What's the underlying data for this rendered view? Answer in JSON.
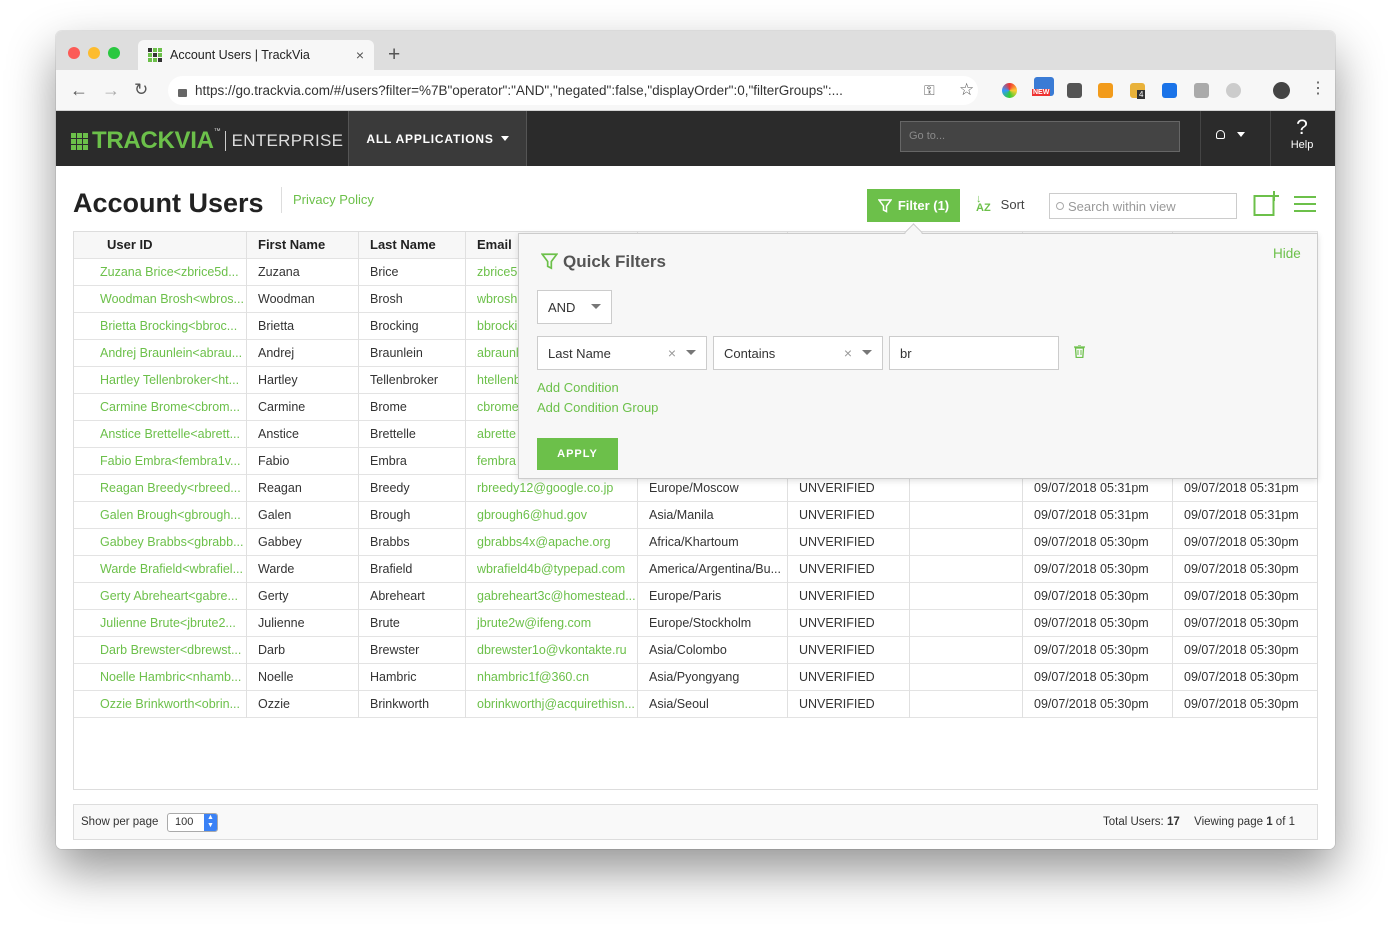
{
  "browser": {
    "tab_title": "Account Users | TrackVia",
    "new_tab": "+",
    "url": "https://go.trackvia.com/#/users?filter=%7B\"operator\":\"AND\",\"negated\":false,\"displayOrder\":0,\"filterGroups\":...",
    "ext_new_badge": "NEW",
    "ext_count_badge": "4"
  },
  "app": {
    "logo_main": "TRACKVIA",
    "logo_tm": "™",
    "logo_sub": "ENTERPRISE",
    "all_apps": "ALL APPLICATIONS",
    "goto_placeholder": "Go to...",
    "help_icon": "?",
    "help": "Help"
  },
  "page": {
    "title": "Account Users",
    "privacy": "Privacy Policy",
    "filter_btn": "Filter (1)",
    "sort": "Sort",
    "search_placeholder": "Search within view"
  },
  "table": {
    "headers": [
      "User ID",
      "First Name",
      "Last Name",
      "Email"
    ],
    "rows": [
      [
        "Zuzana Brice<zbrice5d...",
        "Zuzana",
        "Brice",
        "zbrice5",
        "",
        "",
        "",
        "",
        ""
      ],
      [
        "Woodman Brosh<wbros...",
        "Woodman",
        "Brosh",
        "wbrosh",
        "",
        "",
        "",
        "",
        ""
      ],
      [
        "Brietta Brocking<bbroc...",
        "Brietta",
        "Brocking",
        "bbrocki",
        "",
        "",
        "",
        "",
        ""
      ],
      [
        "Andrej Braunlein<abrau...",
        "Andrej",
        "Braunlein",
        "abraunl",
        "",
        "",
        "",
        "",
        ""
      ],
      [
        "Hartley Tellenbroker<ht...",
        "Hartley",
        "Tellenbroker",
        "htellenb",
        "",
        "",
        "",
        "",
        ""
      ],
      [
        "Carmine Brome<cbrom...",
        "Carmine",
        "Brome",
        "cbrome",
        "",
        "",
        "",
        "",
        ""
      ],
      [
        "Anstice Brettelle<abrett...",
        "Anstice",
        "Brettelle",
        "abrette",
        "",
        "",
        "",
        "",
        ""
      ],
      [
        "Fabio Embra<fembra1v...",
        "Fabio",
        "Embra",
        "fembra",
        "",
        "",
        "",
        "",
        ""
      ],
      [
        "Reagan Breedy<rbreed...",
        "Reagan",
        "Breedy",
        "rbreedy12@google.co.jp",
        "Europe/Moscow",
        "UNVERIFIED",
        "",
        "09/07/2018 05:31pm",
        "09/07/2018 05:31pm"
      ],
      [
        "Galen Brough<gbrough...",
        "Galen",
        "Brough",
        "gbrough6@hud.gov",
        "Asia/Manila",
        "UNVERIFIED",
        "",
        "09/07/2018 05:31pm",
        "09/07/2018 05:31pm"
      ],
      [
        "Gabbey Brabbs<gbrabb...",
        "Gabbey",
        "Brabbs",
        "gbrabbs4x@apache.org",
        "Africa/Khartoum",
        "UNVERIFIED",
        "",
        "09/07/2018 05:30pm",
        "09/07/2018 05:30pm"
      ],
      [
        "Warde Brafield<wbrafiel...",
        "Warde",
        "Brafield",
        "wbrafield4b@typepad.com",
        "America/Argentina/Bu...",
        "UNVERIFIED",
        "",
        "09/07/2018 05:30pm",
        "09/07/2018 05:30pm"
      ],
      [
        "Gerty Abreheart<gabre...",
        "Gerty",
        "Abreheart",
        "gabreheart3c@homestead...",
        "Europe/Paris",
        "UNVERIFIED",
        "",
        "09/07/2018 05:30pm",
        "09/07/2018 05:30pm"
      ],
      [
        "Julienne Brute<jbrute2...",
        "Julienne",
        "Brute",
        "jbrute2w@ifeng.com",
        "Europe/Stockholm",
        "UNVERIFIED",
        "",
        "09/07/2018 05:30pm",
        "09/07/2018 05:30pm"
      ],
      [
        "Darb Brewster<dbrewst...",
        "Darb",
        "Brewster",
        "dbrewster1o@vkontakte.ru",
        "Asia/Colombo",
        "UNVERIFIED",
        "",
        "09/07/2018 05:30pm",
        "09/07/2018 05:30pm"
      ],
      [
        "Noelle Hambric<nhamb...",
        "Noelle",
        "Hambric",
        "nhambric1f@360.cn",
        "Asia/Pyongyang",
        "UNVERIFIED",
        "",
        "09/07/2018 05:30pm",
        "09/07/2018 05:30pm"
      ],
      [
        "Ozzie Brinkworth<obrin...",
        "Ozzie",
        "Brinkworth",
        "obrinkworthj@acquirethisn...",
        "Asia/Seoul",
        "UNVERIFIED",
        "",
        "09/07/2018 05:30pm",
        "09/07/2018 05:30pm"
      ]
    ]
  },
  "footer": {
    "per_page_label": "Show per page",
    "per_page_value": "100",
    "total_label": "Total Users:",
    "total": "17",
    "viewing_label": "Viewing page",
    "page": "1",
    "of_label": "of",
    "pages": "1"
  },
  "quick_filters": {
    "title": "Quick Filters",
    "hide": "Hide",
    "operator": "AND",
    "field": "Last Name",
    "condition": "Contains",
    "value": "br",
    "clear": "×",
    "add_condition": "Add Condition",
    "add_group": "Add Condition Group",
    "apply": "APPLY"
  },
  "colors": {
    "accent": "#6cc04a",
    "header": "#2b2b2b"
  }
}
